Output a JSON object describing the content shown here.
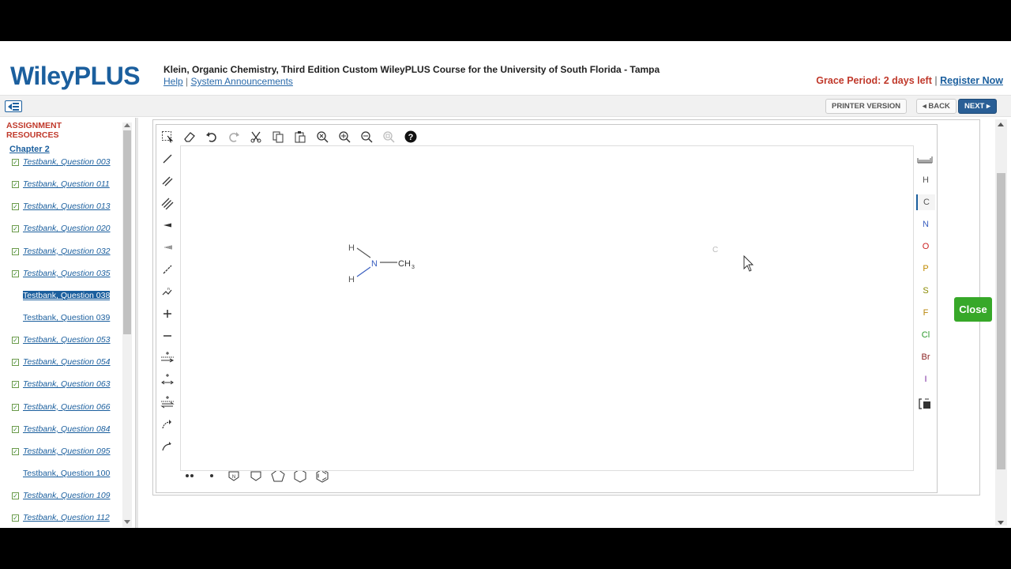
{
  "header": {
    "logo": "WileyPLUS",
    "course_title": "Klein, Organic Chemistry, Third Edition Custom WileyPLUS Course for the University of South Florida - Tampa",
    "help": "Help",
    "link_separator": "|",
    "announcements": "System Announcements",
    "grace_period": "Grace Period: 2 days left",
    "register": "Register Now"
  },
  "navbar": {
    "printer": "PRINTER VERSION",
    "back": "◂ BACK",
    "next": "NEXT ▸"
  },
  "sidebar": {
    "title": "ASSIGNMENT RESOURCES",
    "chapter": "Chapter 2",
    "questions": [
      {
        "label": "Testbank, Question 003",
        "done": true,
        "selected": false
      },
      {
        "label": "Testbank, Question 011",
        "done": true,
        "selected": false
      },
      {
        "label": "Testbank, Question 013",
        "done": true,
        "selected": false
      },
      {
        "label": "Testbank, Question 020",
        "done": true,
        "selected": false
      },
      {
        "label": "Testbank, Question 032",
        "done": true,
        "selected": false
      },
      {
        "label": "Testbank, Question 035",
        "done": true,
        "selected": false
      },
      {
        "label": "Testbank, Question 038",
        "done": false,
        "selected": true
      },
      {
        "label": "Testbank, Question 039",
        "done": false,
        "selected": false
      },
      {
        "label": "Testbank, Question 053",
        "done": true,
        "selected": false
      },
      {
        "label": "Testbank, Question 054",
        "done": true,
        "selected": false
      },
      {
        "label": "Testbank, Question 063",
        "done": true,
        "selected": false
      },
      {
        "label": "Testbank, Question 066",
        "done": true,
        "selected": false
      },
      {
        "label": "Testbank, Question 084",
        "done": true,
        "selected": false
      },
      {
        "label": "Testbank, Question 095",
        "done": true,
        "selected": false
      },
      {
        "label": "Testbank, Question 100",
        "done": false,
        "selected": false
      },
      {
        "label": "Testbank, Question 109",
        "done": true,
        "selected": false
      },
      {
        "label": "Testbank, Question 112",
        "done": true,
        "selected": false
      }
    ]
  },
  "editor": {
    "molecule": {
      "h_top": "H",
      "h_bottom": "H",
      "n": "N",
      "ch": "CH",
      "sub": "3"
    },
    "cursor_atom": "C",
    "elements": [
      {
        "symbol": "H",
        "color": "#555555"
      },
      {
        "symbol": "C",
        "color": "#555555"
      },
      {
        "symbol": "N",
        "color": "#3a5fc0"
      },
      {
        "symbol": "O",
        "color": "#cc2222"
      },
      {
        "symbol": "P",
        "color": "#c08a00"
      },
      {
        "symbol": "S",
        "color": "#8a8a00"
      },
      {
        "symbol": "F",
        "color": "#b8860b"
      },
      {
        "symbol": "Cl",
        "color": "#2e9a2e"
      },
      {
        "symbol": "Br",
        "color": "#8b2222"
      },
      {
        "symbol": "I",
        "color": "#7a2aa0"
      }
    ],
    "close": "Close"
  }
}
